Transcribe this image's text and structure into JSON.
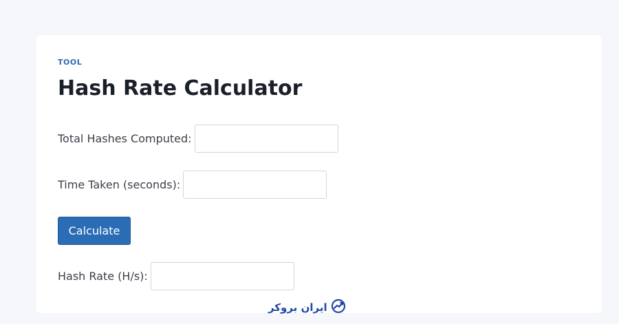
{
  "card": {
    "eyebrow": "TOOL",
    "title": "Hash Rate Calculator"
  },
  "form": {
    "total_hashes_label": "Total Hashes Computed:",
    "total_hashes_value": "",
    "time_label": "Time Taken (seconds):",
    "time_value": "",
    "calculate_label": "Calculate",
    "hash_rate_label": "Hash Rate (H/s):",
    "hash_rate_value": ""
  },
  "watermark": {
    "text": "ایران بروکر",
    "icon": "trend-circle-logo-icon"
  },
  "colors": {
    "accent": "#2a6db5",
    "eyebrow": "#2e6db0",
    "background": "#f5f7fb",
    "watermark": "#2146a8"
  }
}
